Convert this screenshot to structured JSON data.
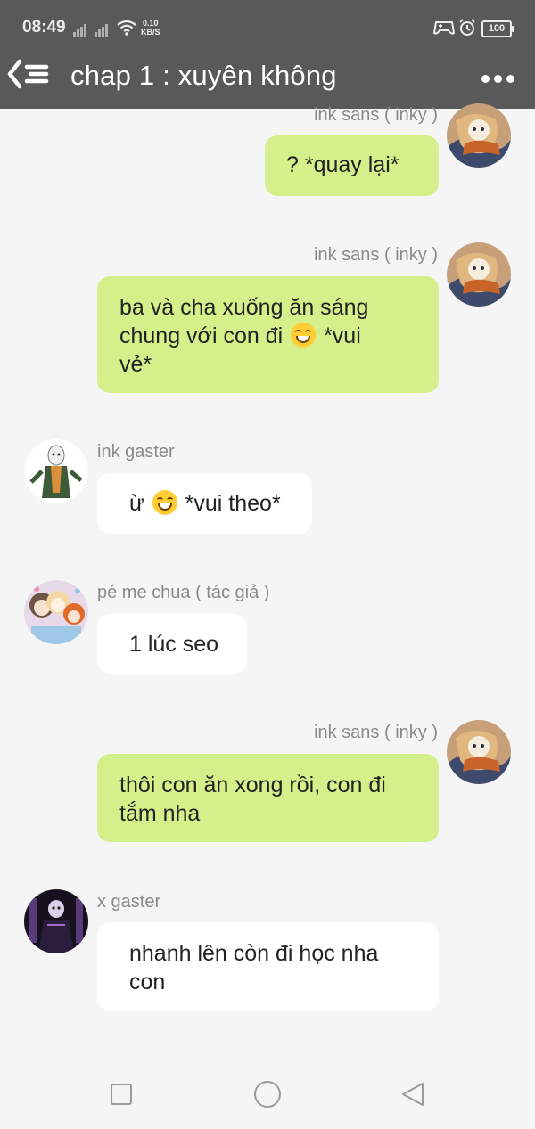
{
  "status_bar": {
    "time": "08:49",
    "net_speed_value": "0.10",
    "net_speed_unit": "KB/S",
    "battery": "100"
  },
  "header": {
    "title": "chap 1 : xuyên không",
    "back_icon": "back-list-icon",
    "more_icon": "more-dots-icon"
  },
  "messages": [
    {
      "sender": "ink sans ( inky )",
      "side": "right",
      "text": "? *quay lại*"
    },
    {
      "sender": "ink sans ( inky )",
      "side": "right",
      "text_lines": [
        "ba và cha xuống ăn sáng",
        "chung với con đi",
        "*vui",
        "vẻ*"
      ]
    },
    {
      "sender": "ink gaster",
      "side": "left",
      "text_before": "ừ",
      "text_after": "*vui theo*"
    },
    {
      "sender": "pé me chua ( tác giả )",
      "side": "left",
      "text": "1 lúc seo"
    },
    {
      "sender": "ink sans ( inky )",
      "side": "right",
      "text_lines": [
        "thôi con ăn xong rồi, con đi",
        "tắm nha"
      ]
    },
    {
      "sender": "x gaster",
      "side": "left",
      "text_lines": [
        "nhanh lên còn đi học nha",
        "con"
      ]
    }
  ],
  "colors": {
    "header_bg": "#595959",
    "outgoing_bubble": "#d5f08b",
    "incoming_bubble": "#ffffff",
    "background": "#f5f5f5"
  }
}
